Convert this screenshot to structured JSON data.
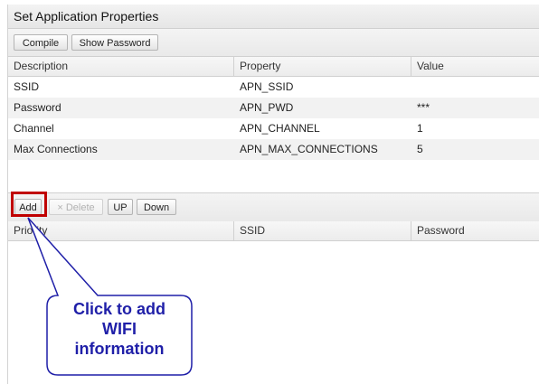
{
  "panel": {
    "title": "Set Application Properties"
  },
  "toolbar1": {
    "compile_label": "Compile",
    "show_password_label": "Show Password"
  },
  "properties": {
    "columns": [
      "Description",
      "Property",
      "Value"
    ],
    "rows": [
      {
        "description": "SSID",
        "property": "APN_SSID",
        "value": ""
      },
      {
        "description": "Password",
        "property": "APN_PWD",
        "value": "***"
      },
      {
        "description": "Channel",
        "property": "APN_CHANNEL",
        "value": "1"
      },
      {
        "description": "Max Connections",
        "property": "APN_MAX_CONNECTIONS",
        "value": "5"
      }
    ]
  },
  "toolbar2": {
    "add_label": "Add",
    "delete_icon": "×",
    "delete_label": "Delete",
    "up_label": "UP",
    "down_label": "Down"
  },
  "wifi": {
    "columns": [
      "Priority",
      "SSID",
      "Password"
    ]
  },
  "annotation": {
    "line1": "Click to add",
    "line2": "WIFI",
    "line3": "information"
  },
  "colors": {
    "highlight": "#c00000",
    "callout_border": "#1f1fa8",
    "callout_text": "#1f1fa8"
  }
}
